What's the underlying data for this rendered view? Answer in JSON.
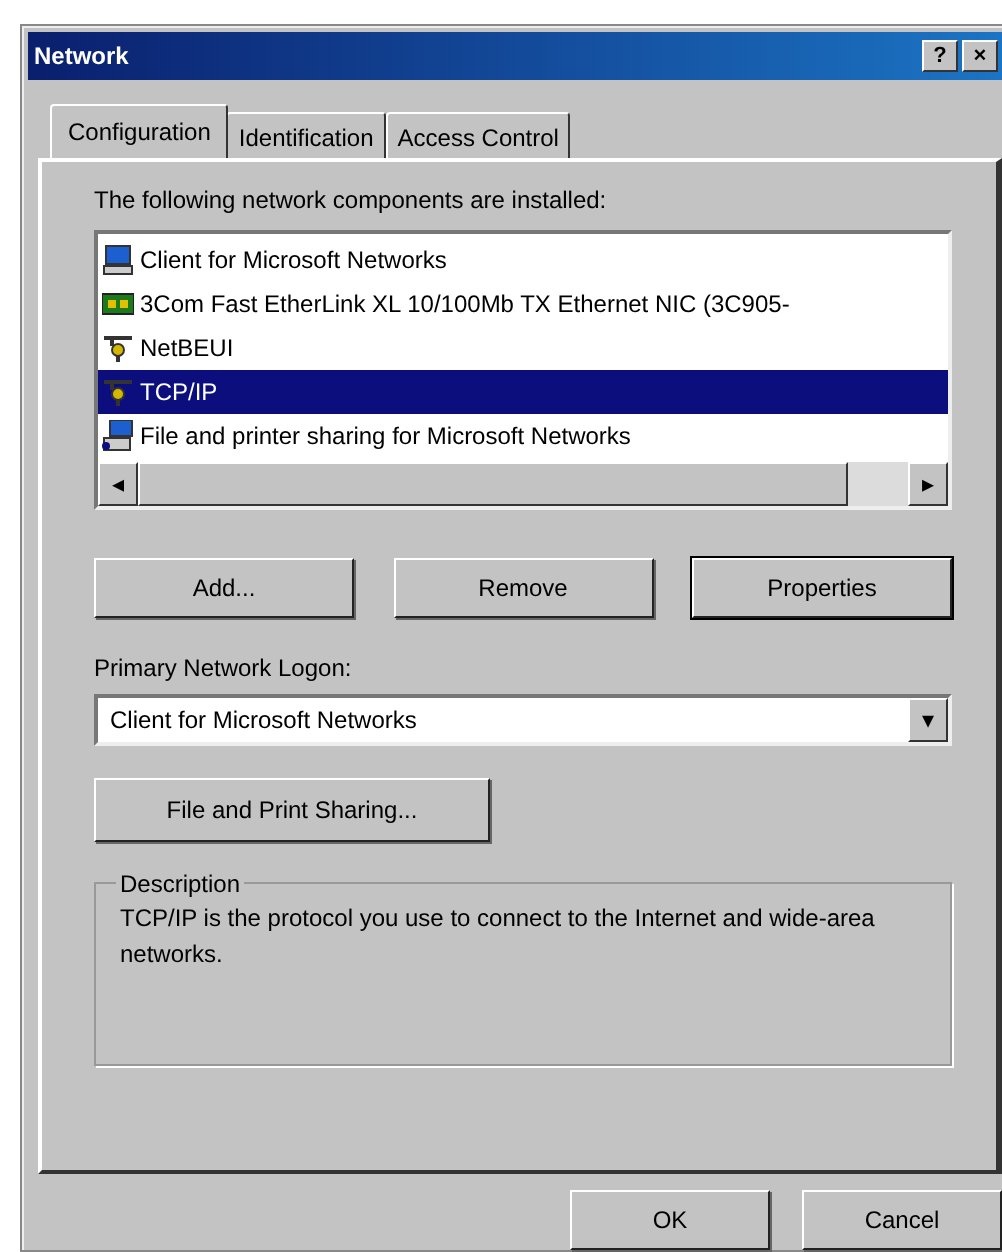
{
  "window": {
    "title": "Network",
    "help_button": "?",
    "close_button": "×"
  },
  "tabs": [
    {
      "label": "Configuration",
      "selected": true
    },
    {
      "label": "Identification",
      "selected": false
    },
    {
      "label": "Access Control",
      "selected": false
    }
  ],
  "components_label": "The following network components are installed:",
  "components": [
    {
      "label": "Client for Microsoft Networks",
      "kind": "client",
      "selected": false
    },
    {
      "label": "3Com Fast EtherLink XL 10/100Mb TX Ethernet NIC (3C905-",
      "kind": "adapter",
      "selected": false
    },
    {
      "label": "NetBEUI",
      "kind": "protocol",
      "selected": false
    },
    {
      "label": "TCP/IP",
      "kind": "protocol",
      "selected": true
    },
    {
      "label": "File and printer sharing for Microsoft Networks",
      "kind": "service",
      "selected": false
    }
  ],
  "scrollbar": {
    "left": "◂",
    "right": "▸"
  },
  "component_buttons": [
    {
      "label": "Add...",
      "default": false
    },
    {
      "label": "Remove",
      "default": false
    },
    {
      "label": "Properties",
      "default": true
    }
  ],
  "logon": {
    "label": "Primary Network Logon:",
    "value": "Client for Microsoft Networks",
    "arrow": "▾"
  },
  "sharing_button": "File and Print Sharing...",
  "description": {
    "legend": "Description",
    "text": "TCP/IP is the protocol you use to connect to the Internet and wide-area networks."
  },
  "dialog_buttons": [
    "OK",
    "Cancel"
  ]
}
